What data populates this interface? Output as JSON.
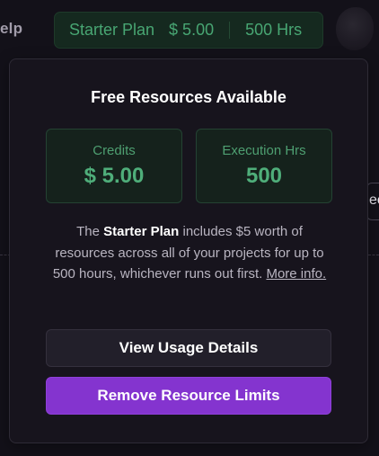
{
  "topbar": {
    "help_text": "elp",
    "plan_pill": {
      "name": "Starter Plan",
      "credit": "$ 5.00",
      "hours": "500 Hrs"
    }
  },
  "background": {
    "right_chip_text": "ec"
  },
  "popover": {
    "title": "Free Resources Available",
    "credits_card": {
      "label": "Credits",
      "value": "$ 5.00"
    },
    "hours_card": {
      "label": "Execution Hrs",
      "value": "500"
    },
    "description": {
      "prefix": "The ",
      "plan_name": "Starter Plan",
      "body": " includes $5 worth of resources across all of your projects for up to 500 hours, whichever runs out first. ",
      "more_link": "More info."
    },
    "buttons": {
      "view_usage": "View Usage Details",
      "remove_limits": "Remove Resource Limits"
    }
  },
  "colors": {
    "background": "#131119",
    "popover_bg": "#17141d",
    "accent_green": "#4fae7a",
    "primary_purple": "#8434cf"
  }
}
